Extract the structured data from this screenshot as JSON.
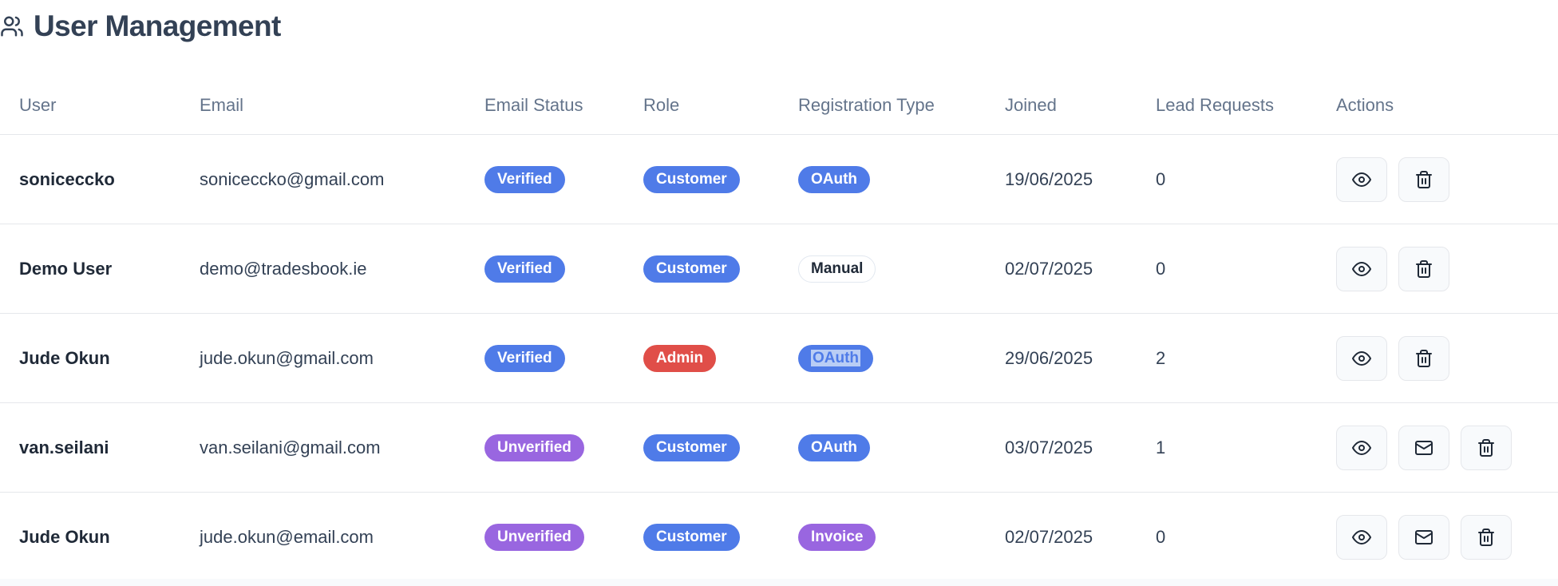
{
  "page": {
    "title": "User Management",
    "title_icon": "users-icon"
  },
  "table": {
    "columns": [
      "User",
      "Email",
      "Email Status",
      "Role",
      "Registration Type",
      "Joined",
      "Lead Requests",
      "Actions"
    ],
    "rows": [
      {
        "user": "soniceccko",
        "email": "soniceccko@gmail.com",
        "email_status": "Verified",
        "role": "Customer",
        "registration_type": "OAuth",
        "joined": "19/06/2025",
        "lead_requests": "0",
        "actions": [
          "eye-icon",
          "trash-icon"
        ]
      },
      {
        "user": "Demo User",
        "email": "demo@tradesbook.ie",
        "email_status": "Verified",
        "role": "Customer",
        "registration_type": "Manual",
        "joined": "02/07/2025",
        "lead_requests": "0",
        "actions": [
          "eye-icon",
          "trash-icon"
        ]
      },
      {
        "user": "Jude Okun",
        "email": "jude.okun@gmail.com",
        "email_status": "Verified",
        "role": "Admin",
        "registration_type": "OAuth",
        "joined": "29/06/2025",
        "lead_requests": "2",
        "actions": [
          "eye-icon",
          "trash-icon"
        ]
      },
      {
        "user": "van.seilani",
        "email": "van.seilani@gmail.com",
        "email_status": "Unverified",
        "role": "Customer",
        "registration_type": "OAuth",
        "joined": "03/07/2025",
        "lead_requests": "1",
        "actions": [
          "eye-icon",
          "mail-icon",
          "trash-icon"
        ]
      },
      {
        "user": "Jude Okun",
        "email": "jude.okun@email.com",
        "email_status": "Unverified",
        "role": "Customer",
        "registration_type": "Invoice",
        "joined": "02/07/2025",
        "lead_requests": "0",
        "actions": [
          "eye-icon",
          "mail-icon",
          "trash-icon"
        ]
      }
    ]
  },
  "colors": {
    "badge_blue": "#4f7be8",
    "badge_purple": "#9966e0",
    "badge_red": "#e04e48",
    "title_text": "#334155",
    "header_text": "#64748b"
  }
}
